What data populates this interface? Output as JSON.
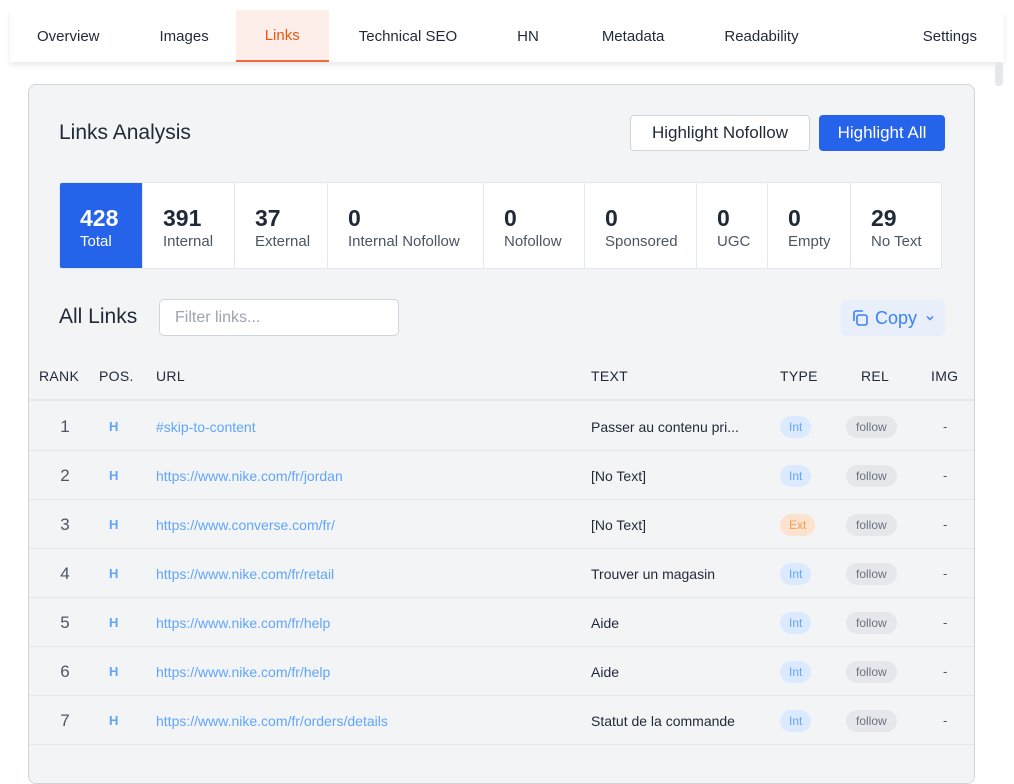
{
  "tabs": [
    {
      "label": "Overview"
    },
    {
      "label": "Images"
    },
    {
      "label": "Links"
    },
    {
      "label": "Technical SEO"
    },
    {
      "label": "HN"
    },
    {
      "label": "Metadata"
    },
    {
      "label": "Readability"
    },
    {
      "label": "Settings"
    }
  ],
  "active_tab": "Links",
  "panel": {
    "title": "Links Analysis",
    "highlight_nofollow_label": "Highlight Nofollow",
    "highlight_all_label": "Highlight All"
  },
  "stats": [
    {
      "value": "428",
      "label": "Total"
    },
    {
      "value": "391",
      "label": "Internal"
    },
    {
      "value": "37",
      "label": "External"
    },
    {
      "value": "0",
      "label": "Internal Nofollow"
    },
    {
      "value": "0",
      "label": "Nofollow"
    },
    {
      "value": "0",
      "label": "Sponsored"
    },
    {
      "value": "0",
      "label": "UGC"
    },
    {
      "value": "0",
      "label": "Empty"
    },
    {
      "value": "29",
      "label": "No Text"
    }
  ],
  "all_links": {
    "title": "All Links",
    "filter_placeholder": "Filter links...",
    "copy_label": "Copy"
  },
  "table": {
    "headers": {
      "rank": "RANK",
      "pos": "POS.",
      "url": "URL",
      "text": "TEXT",
      "type": "TYPE",
      "rel": "REL",
      "img": "IMG"
    },
    "rows": [
      {
        "rank": "1",
        "pos": "H",
        "url": "#skip-to-content",
        "text": "Passer au contenu pri...",
        "type": "Int",
        "rel": "follow",
        "img": "-"
      },
      {
        "rank": "2",
        "pos": "H",
        "url": "https://www.nike.com/fr/jordan",
        "text": "[No Text]",
        "type": "Int",
        "rel": "follow",
        "img": "-"
      },
      {
        "rank": "3",
        "pos": "H",
        "url": "https://www.converse.com/fr/",
        "text": "[No Text]",
        "type": "Ext",
        "rel": "follow",
        "img": "-"
      },
      {
        "rank": "4",
        "pos": "H",
        "url": "https://www.nike.com/fr/retail",
        "text": "Trouver un magasin",
        "type": "Int",
        "rel": "follow",
        "img": "-"
      },
      {
        "rank": "5",
        "pos": "H",
        "url": "https://www.nike.com/fr/help",
        "text": "Aide",
        "type": "Int",
        "rel": "follow",
        "img": "-"
      },
      {
        "rank": "6",
        "pos": "H",
        "url": "https://www.nike.com/fr/help",
        "text": "Aide",
        "type": "Int",
        "rel": "follow",
        "img": "-"
      },
      {
        "rank": "7",
        "pos": "H",
        "url": "https://www.nike.com/fr/orders/details",
        "text": "Statut de la commande",
        "type": "Int",
        "rel": "follow",
        "img": "-"
      }
    ]
  },
  "colors": {
    "accent": "#2563eb",
    "active_tab": "#ea580c",
    "link": "#60a5fa"
  },
  "icons": {
    "copy": "copy-icon",
    "dropdown": "chevron-down-icon"
  }
}
